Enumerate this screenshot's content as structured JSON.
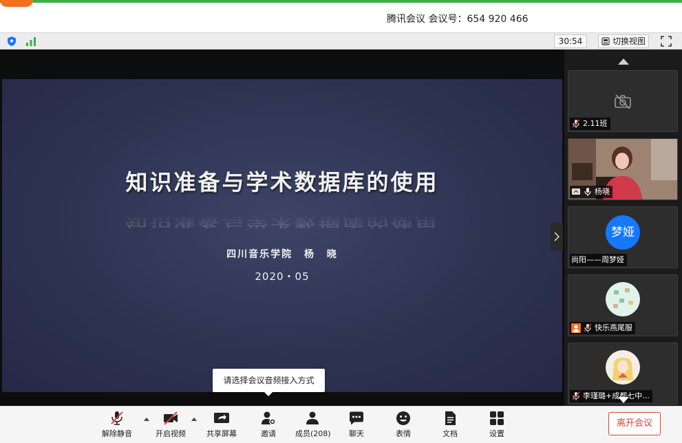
{
  "titlebar": {
    "title": "腾讯会议 会议号：654 920 466"
  },
  "statusbar": {
    "timer": "30:54",
    "switch_view": "切换视图"
  },
  "slide": {
    "title": "知识准备与学术数据库的使用",
    "author": "四川音乐学院 杨 晓",
    "date": "2020・05"
  },
  "participants": [
    {
      "label": "2.11班",
      "tile": "camera-off",
      "mic": "muted"
    },
    {
      "label": "杨晓",
      "tile": "video",
      "mic": "on",
      "sharing": true
    },
    {
      "label": "尚阳——周梦娅",
      "tile": "avatar-text",
      "avatar_text": "梦娅",
      "avatar_color": "#1677ff",
      "mic": "none"
    },
    {
      "label": "快乐燕尾服",
      "tile": "avatar-image",
      "mic": "muted",
      "host_icon": true
    },
    {
      "label": "李瑾璐+成都七中...",
      "tile": "avatar-image",
      "mic": "muted"
    }
  ],
  "tooltip": {
    "text": "请选择会议音频接入方式"
  },
  "toolbar": {
    "unmute": "解除静音",
    "start_video": "开启视频",
    "share_screen": "共享屏幕",
    "invite": "邀请",
    "members": "成员(208)",
    "chat": "聊天",
    "reactions": "表情",
    "docs": "文档",
    "settings": "设置",
    "leave": "离开会议"
  },
  "colors": {
    "accent_green": "#3fae49",
    "leave_red": "#e0413a",
    "avatar_blue": "#1677ff"
  }
}
